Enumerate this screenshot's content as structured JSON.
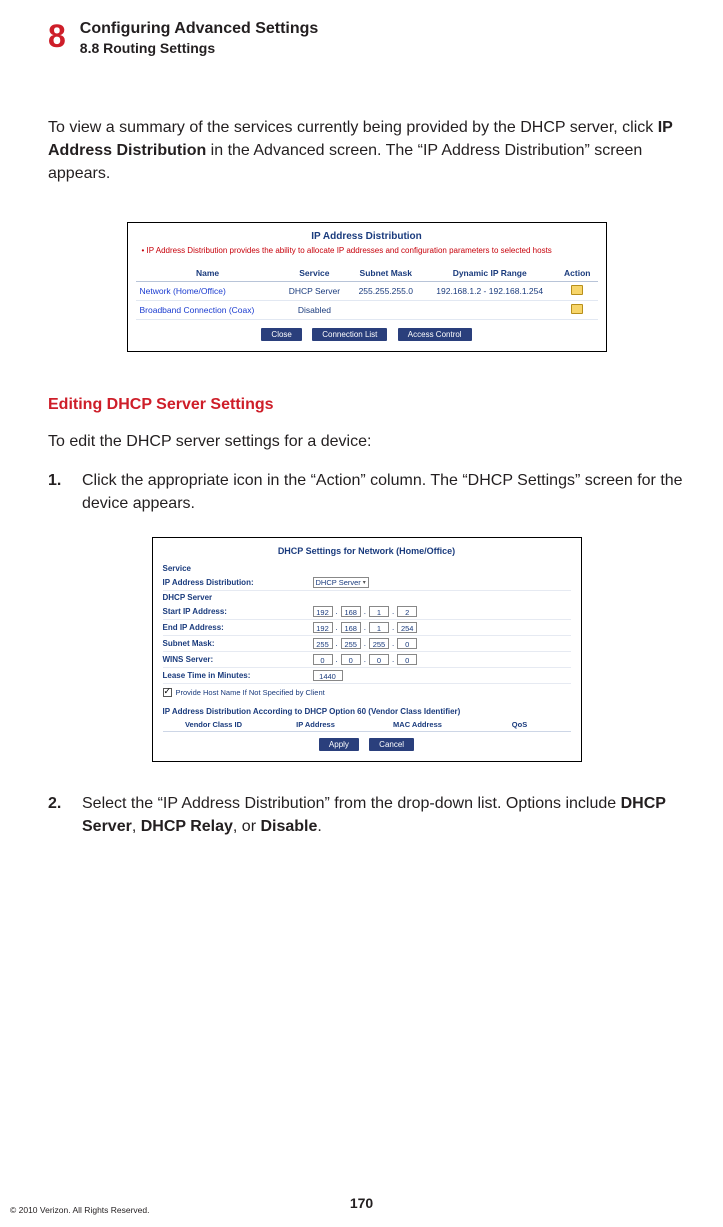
{
  "header": {
    "chapter_number": "8",
    "title_line1": "Configuring Advanced Settings",
    "title_line2": "8.8 Routing Settings"
  },
  "intro": {
    "pre": "To view a summary of the services currently being provided by the DHCP server, click ",
    "bold": "IP Address Distribution",
    "post": " in the Advanced screen. The “IP Address Distribution” screen appears."
  },
  "fig1": {
    "title": "IP Address Distribution",
    "hint": "IP Address Distribution provides the ability to allocate IP addresses and configuration parameters to selected hosts",
    "columns": [
      "Name",
      "Service",
      "Subnet Mask",
      "Dynamic IP Range",
      "Action"
    ],
    "rows": [
      {
        "name": "Network (Home/Office)",
        "service": "DHCP Server",
        "mask": "255.255.255.0",
        "range": "192.168.1.2 - 192.168.1.254"
      },
      {
        "name": "Broadband Connection (Coax)",
        "service": "Disabled",
        "mask": "",
        "range": ""
      }
    ],
    "buttons": [
      "Close",
      "Connection List",
      "Access Control"
    ]
  },
  "section_heading": "Editing DHCP Server Settings",
  "section_intro": "To edit the DHCP server settings for a device:",
  "steps": {
    "s1": {
      "num": "1.",
      "text": "Click the appropriate icon in the “Action” column. The “DHCP Settings” screen for the device appears."
    },
    "s2": {
      "num": "2.",
      "pre": "Select the “IP Address Distribution” from the drop-down list. Options include ",
      "b1": "DHCP Server",
      "sep1": ", ",
      "b2": "DHCP Relay",
      "sep2": ", or ",
      "b3": "Disable",
      "post": "."
    }
  },
  "fig2": {
    "title": "DHCP Settings for Network (Home/Office)",
    "service_label": "Service",
    "ipdist_label": "IP Address Distribution:",
    "ipdist_value": "DHCP Server",
    "dhcp_server_label": "DHCP Server",
    "start_label": "Start IP Address:",
    "start_ip": [
      "192",
      "168",
      "1",
      "2"
    ],
    "end_label": "End IP Address:",
    "end_ip": [
      "192",
      "168",
      "1",
      "254"
    ],
    "subnet_label": "Subnet Mask:",
    "subnet": [
      "255",
      "255",
      "255",
      "0"
    ],
    "wins_label": "WINS Server:",
    "wins": [
      "0",
      "0",
      "0",
      "0"
    ],
    "lease_label": "Lease Time in Minutes:",
    "lease_value": "1440",
    "checkbox_label": "Provide Host Name If Not Specified by Client",
    "opt60_label": "IP Address Distribution According to DHCP Option 60 (Vendor Class Identifier)",
    "opt60_cols": [
      "Vendor Class ID",
      "IP Address",
      "MAC Address",
      "QoS"
    ],
    "buttons": [
      "Apply",
      "Cancel"
    ]
  },
  "footer": {
    "page_number": "170",
    "copyright": "© 2010 Verizon. All Rights Reserved."
  }
}
